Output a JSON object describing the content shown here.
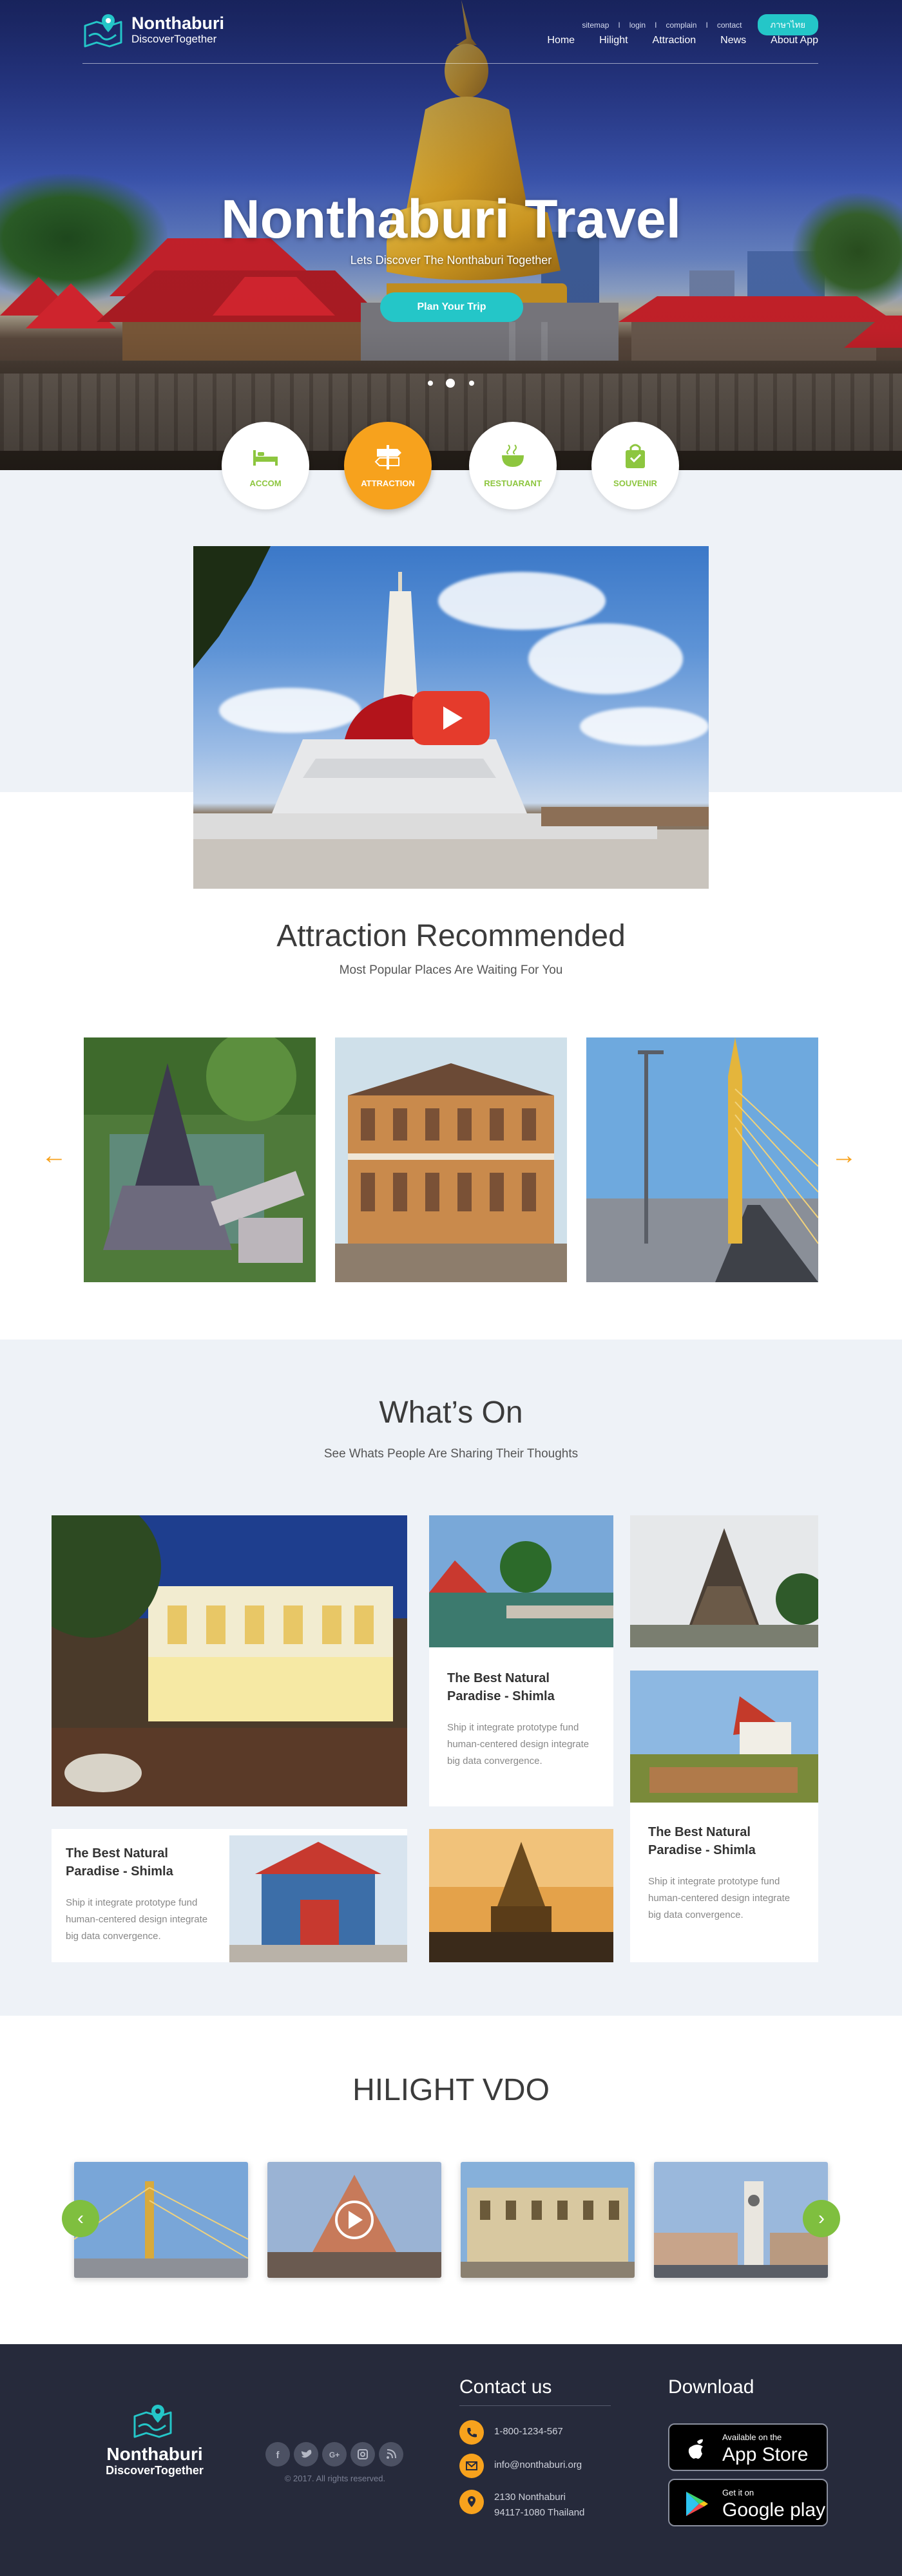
{
  "brand": {
    "name": "Nonthaburi",
    "tagline": "DiscoverTogether"
  },
  "topbar": {
    "links": [
      "sitemap",
      "login",
      "complain",
      "contact"
    ],
    "separator": "I",
    "language_button": "ภาษาไทย"
  },
  "nav": [
    "Home",
    "Hilight",
    "Attraction",
    "News",
    "About App"
  ],
  "hero": {
    "title": "Nonthaburi Travel",
    "subtitle": "Lets Discover The Nonthaburi Together",
    "cta": "Plan Your Trip",
    "slides": 3,
    "active_slide": 2
  },
  "categories": [
    {
      "label": "ACCOM",
      "icon": "bed-icon",
      "active": false
    },
    {
      "label": "ATTRACTION",
      "icon": "signpost-icon",
      "active": true
    },
    {
      "label": "RESTUARANT",
      "icon": "bowl-icon",
      "active": false
    },
    {
      "label": "SOUVENIR",
      "icon": "shopping-bag-icon",
      "active": false
    }
  ],
  "attractions": {
    "title": "Attraction Recommended",
    "subtitle": "Most Popular Places Are Waiting For You",
    "prev_icon": "arrow-left-icon",
    "next_icon": "arrow-right-icon"
  },
  "whatson": {
    "title": "What’s On",
    "subtitle": "See Whats People Are Sharing Their Thoughts",
    "cards": [
      {
        "title": "The Best Natural Paradise - Shimla",
        "text": "Ship it integrate prototype fund human-centered design integrate big data convergence."
      },
      {
        "title": "The Best Natural Paradise - Shimla",
        "text": "Ship it integrate prototype fund human-centered design integrate big data convergence."
      },
      {
        "title": "The Best Natural Paradise - Shimla",
        "text": "Ship it integrate prototype fund human-centered design integrate big data convergence."
      }
    ]
  },
  "hilight": {
    "title": "HILIGHT VDO",
    "prev_icon": "chevron-left-icon",
    "next_icon": "chevron-right-icon"
  },
  "footer": {
    "brand_name": "Nonthaburi",
    "brand_tag": "DiscoverTogether",
    "social": [
      "facebook-icon",
      "twitter-icon",
      "google-plus-icon",
      "instagram-icon",
      "rss-icon"
    ],
    "copyright": "© 2017. All rights reserved.",
    "contact_title": "Contact us",
    "phone": "1-800-1234-567",
    "email": "info@nonthaburi.org",
    "address_line1": "2130 Nonthaburi",
    "address_line2": "94117-1080 Thailand",
    "download_title": "Download",
    "appstore_small": "Available on the",
    "appstore_big": "App Store",
    "googleplay_small": "Get it on",
    "googleplay_big": "Google play"
  },
  "colors": {
    "accent": "#24c6c8",
    "orange": "#f7a21d",
    "green": "#8dc63f",
    "footer_bg": "#262a3b",
    "section_bg": "#eef2f7"
  }
}
